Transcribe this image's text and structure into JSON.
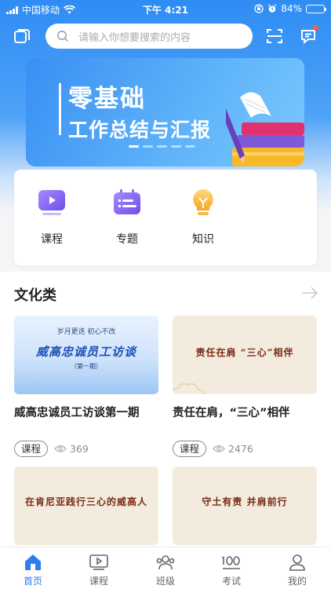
{
  "status_bar": {
    "carrier": "中国移动",
    "time": "下午 4:21",
    "battery": "84%",
    "battery_level": 0.84
  },
  "search": {
    "placeholder": "请输入你想要搜索的内容"
  },
  "banner": {
    "title_line1": "零基础",
    "title_line2": "工作总结与汇报",
    "pages": 5,
    "active_page": 1
  },
  "quick_nav": [
    {
      "label": "课程",
      "icon": "play-video-icon"
    },
    {
      "label": "专题",
      "icon": "topic-list-icon"
    },
    {
      "label": "知识",
      "icon": "lightbulb-icon"
    }
  ],
  "section": {
    "title": "文化类"
  },
  "cards": [
    {
      "title": "威高忠诚员工访谈第一期",
      "tag": "课程",
      "views": "369",
      "thumb": {
        "top_line": "岁月更迭  初心不改",
        "main": "威高忠诚员工访谈",
        "sub": "（第一期）"
      }
    },
    {
      "title": "责任在肩，“三心”相伴",
      "tag": "课程",
      "views": "2476",
      "thumb": {
        "main": "责任在肩  “三心”相伴"
      }
    },
    {
      "thumb": {
        "main": "在肯尼亚践行三心的威高人"
      }
    },
    {
      "thumb": {
        "main": "守土有责  并肩前行"
      }
    }
  ],
  "tabbar": [
    {
      "label": "首页",
      "icon": "home-icon",
      "active": true
    },
    {
      "label": "课程",
      "icon": "video-course-icon"
    },
    {
      "label": "班级",
      "icon": "class-group-icon"
    },
    {
      "label": "考试",
      "icon": "exam-100-icon"
    },
    {
      "label": "我的",
      "icon": "profile-icon"
    }
  ],
  "colors": {
    "primary": "#2d7df2",
    "header_gradient_top": "#2e8cf4",
    "thumb_cream": "#f3ecde",
    "thumb_text": "#7a2a16"
  }
}
